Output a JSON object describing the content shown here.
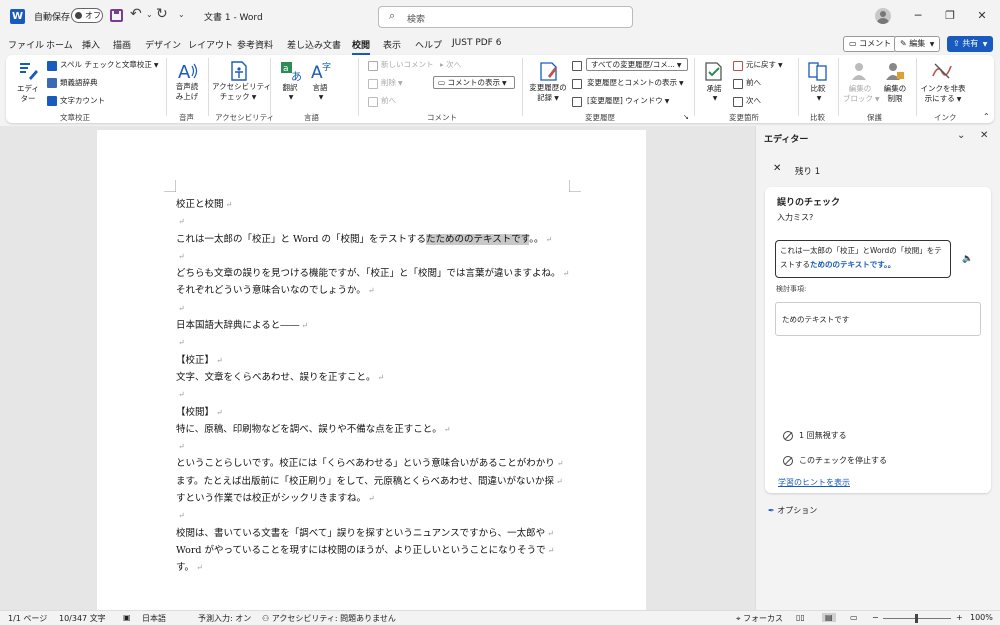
{
  "titlebar": {
    "app_icon_letter": "W",
    "autosave_label": "自動保存",
    "autosave_state": "オフ",
    "doc_title": "文書 1  -  Word",
    "search_placeholder": "検索"
  },
  "menu": {
    "tabs": [
      "ファイル",
      "ホーム",
      "挿入",
      "描画",
      "デザイン",
      "レイアウト",
      "参考資料",
      "差し込み文書",
      "校閲",
      "表示",
      "ヘルプ",
      "JUST PDF 6"
    ],
    "active_index": 8,
    "comment_button": "コメント",
    "edit_button": "編集",
    "share_button": "共有"
  },
  "ribbon": {
    "proofing": {
      "editor_label_1": "エディ",
      "editor_label_2": "ター",
      "spell": "スペル チェックと文章校正",
      "thesaurus": "類義語辞典",
      "wordcount": "文字カウント",
      "group": "文章校正"
    },
    "speech": {
      "read_1": "音声読",
      "read_2": "み上げ",
      "group": "音声"
    },
    "accessibility": {
      "check_1": "アクセシビリティ",
      "check_2": "チェック",
      "group": "アクセシビリティ"
    },
    "language": {
      "translate": "翻訳",
      "language": "言語",
      "group": "言語"
    },
    "comments": {
      "new": "新しいコメント",
      "delete": "削除",
      "prev": "前へ",
      "next": "次へ",
      "show": "コメントの表示",
      "group": "コメント"
    },
    "tracking": {
      "track_1": "変更履歴の",
      "track_2": "記録",
      "markup": "すべての変更履歴/コメ...",
      "show_markup": "変更履歴とコメントの表示",
      "pane": "[変更履歴] ウィンドウ",
      "group": "変更履歴"
    },
    "changes": {
      "accept": "承諾",
      "reject": "元に戻す",
      "prev": "前へ",
      "next": "次へ",
      "group": "変更箇所"
    },
    "compare": {
      "compare": "比較",
      "group": "比較"
    },
    "protect": {
      "block_1": "編集の",
      "block_2": "ブロック",
      "restrict_1": "編集の",
      "restrict_2": "制限",
      "group": "保護"
    },
    "ink": {
      "hide_1": "インクを非表",
      "hide_2": "示にする",
      "group": "インク"
    }
  },
  "document": {
    "paragraphs": [
      {
        "t": "校正と校閲"
      },
      {
        "t": ""
      },
      {
        "pre": "これは一太郎の「校正」と Word の「校閲」をテストする",
        "hl": "たためののテキストです",
        "post": "。。"
      },
      {
        "t": ""
      },
      {
        "t": "どちらも文章の誤りを見つける機能ですが、「校正」と「校閲」では言葉が違いますよね。"
      },
      {
        "t": "それぞれどういう意味合いなのでしょうか。",
        "mark": true
      },
      {
        "t": ""
      },
      {
        "t": "日本国語大辞典によると――"
      },
      {
        "t": ""
      },
      {
        "t": "【校正】"
      },
      {
        "t": "文字、文章をくらべあわせ、誤りを正すこと。"
      },
      {
        "t": ""
      },
      {
        "t": "【校閲】"
      },
      {
        "t": "特に、原稿、印刷物などを調べ、誤りや不備な点を正すこと。"
      },
      {
        "t": ""
      },
      {
        "t": "ということらしいです。校正には「くらべあわせる」という意味合いがあることがわかり"
      },
      {
        "t": "ます。たとえば出版前に「校正刷り」をして、元原稿とくらべあわせ、間違いがないか探"
      },
      {
        "t": "すという作業では校正がシックリきますね。"
      },
      {
        "t": ""
      },
      {
        "t": "校閲は、書いている文書を「調べて」誤りを探すというニュアンスですから、一太郎や"
      },
      {
        "t": "Word がやっていることを現すには校閲のほうが、より正しいということになりそうで"
      },
      {
        "t": "す。"
      }
    ]
  },
  "editor": {
    "title": "エディター",
    "remaining": "残り 1",
    "card_title": "誤りのチェック",
    "card_subtitle": "入力ミス?",
    "context_normal": "これは一太郎の「校正」とWordの「校閲」をテストする",
    "context_highlight": "ためののテキストです。。",
    "review_label": "検討事項:",
    "suggestion": "ためのテキストです",
    "ignore_once": "1 回無視する",
    "stop_check": "このチェックを停止する",
    "learn_link": "学習のヒントを表示",
    "options": "オプション"
  },
  "status": {
    "page": "1/1 ページ",
    "words": "10/347 文字",
    "language": "日本語",
    "predict": "予測入力: オン",
    "access": "アクセシビリティ: 問題ありません",
    "focus": "フォーカス",
    "zoom": "100%"
  }
}
